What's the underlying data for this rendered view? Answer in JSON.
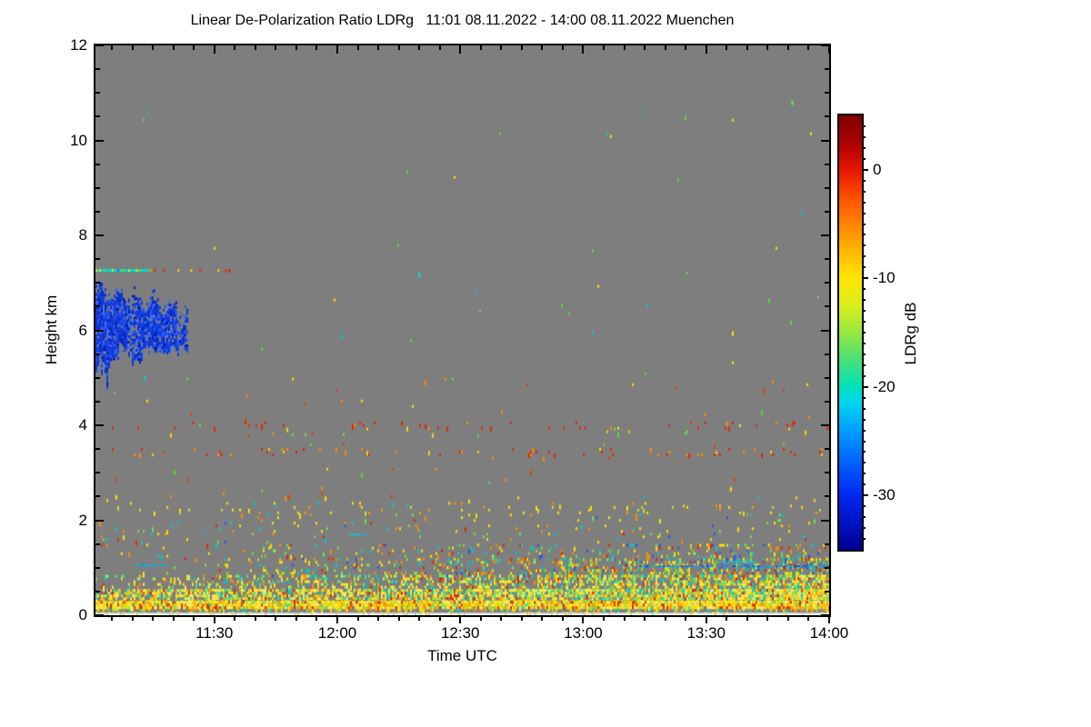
{
  "chart_data": {
    "type": "heatmap",
    "title": "Linear De-Polarization Ratio LDRg   11:01 08.11.2022 - 14:00 08.11.2022 Muenchen",
    "site": "Muenchen",
    "time_start": "11:01 08.11.2022",
    "time_end": "14:00 08.11.2022",
    "xlabel": "Time UTC",
    "ylabel": "Height km",
    "colorbar_label": "LDRg dB",
    "x_total_minutes": 179,
    "x_minor_step_min": 5,
    "x_minor_offset_min": 4,
    "x_ticks": [
      {
        "label": "11:30",
        "minute": 29
      },
      {
        "label": "12:00",
        "minute": 59
      },
      {
        "label": "12:30",
        "minute": 89
      },
      {
        "label": "13:00",
        "minute": 119
      },
      {
        "label": "13:30",
        "minute": 149
      },
      {
        "label": "14:00",
        "minute": 179
      }
    ],
    "y_max_km": 12,
    "y_ticks": [
      0,
      2,
      4,
      6,
      8,
      10,
      12
    ],
    "y_minor_step_km": 0.5,
    "background_color": "#7e7e7e",
    "no_data_strip_color": "#ededed",
    "colorbar": {
      "max_db": 5,
      "min_db": -35,
      "ticks": [
        0,
        -10,
        -20,
        -30
      ],
      "minor_step_db": 1,
      "gradient": [
        [
          0.0,
          "#7f0000"
        ],
        [
          0.06,
          "#a80000"
        ],
        [
          0.125,
          "#e81500"
        ],
        [
          0.2,
          "#ff5a00"
        ],
        [
          0.25,
          "#ff8400"
        ],
        [
          0.31,
          "#ffb400"
        ],
        [
          0.375,
          "#ffe600"
        ],
        [
          0.44,
          "#d8ee20"
        ],
        [
          0.5,
          "#96e83e"
        ],
        [
          0.56,
          "#4ce074"
        ],
        [
          0.625,
          "#00e2bc"
        ],
        [
          0.66,
          "#00d8f0"
        ],
        [
          0.72,
          "#00a2ff"
        ],
        [
          0.8,
          "#0062ff"
        ],
        [
          0.875,
          "#0028f0"
        ],
        [
          0.94,
          "#0012c0"
        ],
        [
          1.0,
          "#000090"
        ]
      ]
    },
    "features": {
      "cloud": {
        "name": "depolarization-cloud",
        "time_min": [
          0,
          22.3
        ],
        "height_km": [
          4.9,
          7.0
        ],
        "palette": [
          [
            "#1040e8",
            5
          ],
          [
            "#0830d8",
            4
          ],
          [
            "#2858f8",
            3
          ],
          [
            "#0020b0",
            2
          ],
          [
            "#4070ff",
            1
          ]
        ]
      },
      "cirrus_line": {
        "height_km": 7.27,
        "dense_t": [
          0,
          12.5
        ],
        "sparse_t": [
          12.5,
          33
        ],
        "dense_cov": 0.92,
        "sparse_cov": 0.22,
        "dense_palette": [
          [
            "#00d8d8",
            4
          ],
          [
            "#48e060",
            3
          ],
          [
            "#c8e820",
            2
          ],
          [
            "#ffd000",
            1
          ],
          [
            "#2070f0",
            1
          ]
        ],
        "sparse_palette": [
          [
            "#48e060",
            2
          ],
          [
            "#ffd000",
            2
          ],
          [
            "#ff8c00",
            2
          ],
          [
            "#e02800",
            1
          ],
          [
            "#00d8d8",
            1
          ]
        ]
      },
      "noise_layers": [
        {
          "h": [
            5.0,
            10.8
          ],
          "density": 0.0007,
          "palette": [
            [
              "#60d840",
              2
            ],
            [
              "#00c8c8",
              1
            ],
            [
              "#ffe000",
              1
            ]
          ]
        },
        {
          "h": [
            2.5,
            5.0
          ],
          "density": 0.004,
          "palette": [
            [
              "#e04000",
              3
            ],
            [
              "#ff8c00",
              3
            ],
            [
              "#ffe000",
              2
            ],
            [
              "#60d840",
              2
            ]
          ]
        },
        {
          "h": [
            3.38,
            3.52
          ],
          "density": 0.055,
          "palette": [
            [
              "#e02800",
              5
            ],
            [
              "#ff8c00",
              3
            ],
            [
              "#ffd000",
              1
            ]
          ]
        },
        {
          "h": [
            3.95,
            4.08
          ],
          "density": 0.03,
          "palette": [
            [
              "#e02800",
              4
            ],
            [
              "#ff8c00",
              1
            ]
          ]
        },
        {
          "h": [
            3.82,
            3.95
          ],
          "density": 0.012,
          "palette": [
            [
              "#70e048",
              1
            ],
            [
              "#ffd000",
              1
            ]
          ]
        },
        {
          "h": [
            2.3,
            2.5
          ],
          "density": 0.015,
          "palette": [
            [
              "#ffe000",
              2
            ],
            [
              "#ff8c00",
              1
            ],
            [
              "#00c8c8",
              1
            ]
          ]
        },
        {
          "h": [
            2.14,
            2.3
          ],
          "density": 0.05,
          "palette": [
            [
              "#ffe000",
              4
            ],
            [
              "#b8e830",
              3
            ],
            [
              "#ff9800",
              2
            ]
          ]
        },
        {
          "h": [
            1.5,
            2.14
          ],
          "density": 0.035,
          "palette": [
            [
              "#ffe000",
              3
            ],
            [
              "#ff8c00",
              2
            ],
            [
              "#00cccc",
              2
            ],
            [
              "#70e048",
              2
            ],
            [
              "#e02800",
              1
            ],
            [
              "#2255ee",
              1
            ]
          ]
        },
        {
          "h": [
            1.2,
            1.5
          ],
          "density": 0.09,
          "right_bias": 0.8,
          "palette": [
            [
              "#ffe000",
              3
            ],
            [
              "#ff8c00",
              2
            ],
            [
              "#00cccc",
              2
            ],
            [
              "#70e048",
              2
            ],
            [
              "#e02800",
              1
            ],
            [
              "#2255ee",
              1
            ]
          ]
        },
        {
          "h": [
            0.85,
            1.2
          ],
          "density": 0.2,
          "right_bias": 1.0,
          "palette": [
            [
              "#ffe000",
              4
            ],
            [
              "#8ae040",
              3
            ],
            [
              "#00cccc",
              2
            ],
            [
              "#ff8c00",
              2
            ],
            [
              "#e02800",
              1
            ],
            [
              "#2255ee",
              1
            ]
          ]
        },
        {
          "h": [
            0.55,
            0.85
          ],
          "density": 0.42,
          "right_bias": 0.7,
          "palette": [
            [
              "#ffe84a",
              5
            ],
            [
              "#ffe000",
              4
            ],
            [
              "#8ae040",
              3
            ],
            [
              "#40dfa0",
              2
            ],
            [
              "#00cccc",
              2
            ],
            [
              "#ff8c00",
              2
            ],
            [
              "#e02800",
              1
            ]
          ]
        },
        {
          "h": [
            0.3,
            0.55
          ],
          "density": 0.75,
          "right_bias": 0.3,
          "palette": [
            [
              "#ffe84a",
              6
            ],
            [
              "#ffd000",
              3
            ],
            [
              "#9ae040",
              3
            ],
            [
              "#ff9800",
              2
            ],
            [
              "#e02800",
              1
            ],
            [
              "#40dfa0",
              2
            ],
            [
              "#00cccc",
              1
            ]
          ]
        },
        {
          "h": [
            0.13,
            0.3
          ],
          "density": 0.97,
          "palette": [
            [
              "#ffe000",
              6
            ],
            [
              "#ffee60",
              4
            ],
            [
              "#ffa000",
              3
            ],
            [
              "#e03000",
              2
            ],
            [
              "#b0e030",
              2
            ],
            [
              "#40dfa0",
              1
            ]
          ]
        },
        {
          "h": [
            0.05,
            0.13
          ],
          "density": 0.5,
          "palette": [
            [
              "#ffe000",
              2
            ],
            [
              "#ff9800",
              1
            ],
            [
              "#9ae040",
              1
            ],
            [
              "#00cccc",
              1
            ],
            [
              "#909090",
              4
            ]
          ]
        }
      ],
      "streaks": [
        {
          "t": [
            131,
            179
          ],
          "h": 1.03,
          "palette": [
            [
              "#2080ff",
              2
            ],
            [
              "#00b8e8",
              2
            ],
            [
              "#1040e0",
              1
            ]
          ]
        },
        {
          "t": [
            152,
            160
          ],
          "h": 1.12,
          "palette": [
            [
              "#00c8e8",
              1
            ]
          ]
        },
        {
          "t": [
            10,
            17
          ],
          "h": 1.05,
          "palette": [
            [
              "#00b8e8",
              1
            ]
          ]
        },
        {
          "t": [
            62,
            66
          ],
          "h": 1.7,
          "palette": [
            [
              "#00c8e8",
              1
            ]
          ]
        }
      ],
      "dots": [
        {
          "t": 79,
          "h": 7.18,
          "color": "#00e0e0"
        },
        {
          "t": 170,
          "h": 10.8,
          "color": "#70e84c"
        },
        {
          "t": 12,
          "h": 5.0,
          "color": "#00d0d0"
        }
      ]
    }
  }
}
